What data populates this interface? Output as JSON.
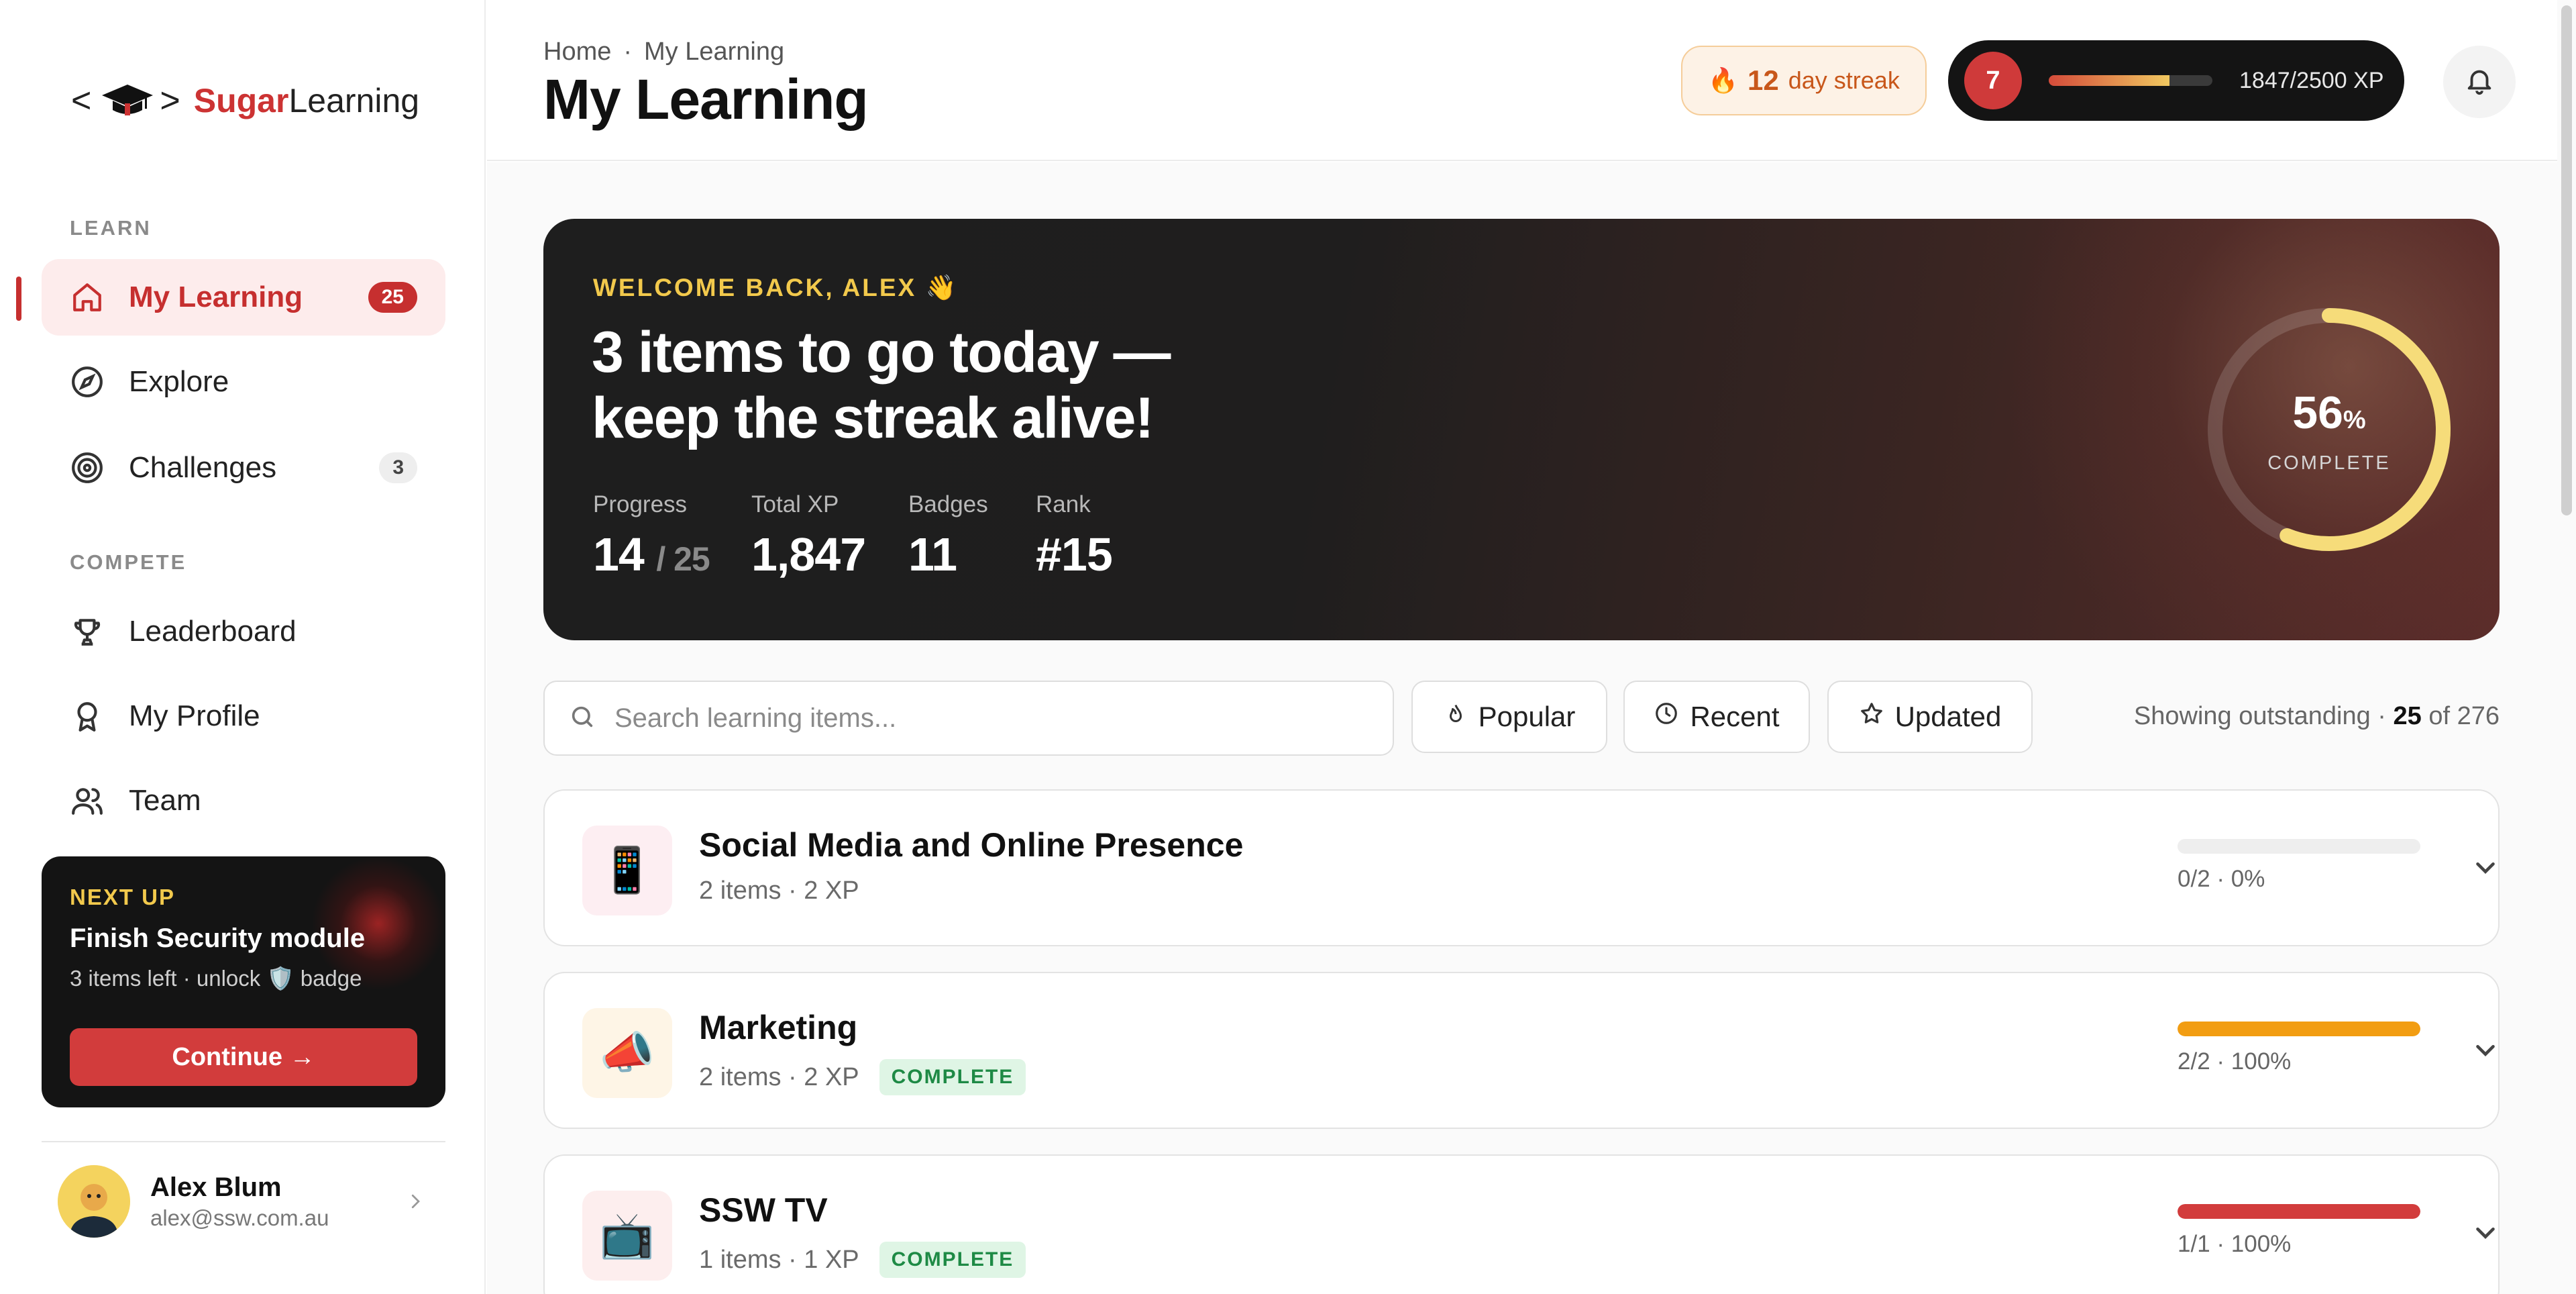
{
  "brand": {
    "bracket_left": "<",
    "bracket_right": ">",
    "name_a": "Sugar",
    "name_b": "Learning"
  },
  "sidebar": {
    "learn_label": "LEARN",
    "compete_label": "COMPETE",
    "items": [
      {
        "label": "My Learning",
        "count": "25",
        "icon": "home-icon",
        "active": true
      },
      {
        "label": "Explore",
        "icon": "compass-icon"
      },
      {
        "label": "Challenges",
        "count": "3",
        "icon": "target-icon"
      },
      {
        "label": "Leaderboard",
        "icon": "trophy-icon"
      },
      {
        "label": "My Profile",
        "icon": "award-icon"
      },
      {
        "label": "Team",
        "icon": "users-icon"
      }
    ],
    "next_up": {
      "tag": "NEXT UP",
      "title": "Finish Security module",
      "sub_prefix": "3 items left · unlock",
      "badge_emoji": "🛡️",
      "sub_suffix": "badge",
      "button": "Continue →"
    },
    "user": {
      "name": "Alex Blum",
      "email": "alex@ssw.com.au"
    }
  },
  "header": {
    "breadcrumb": [
      "Home",
      "·",
      "My Learning"
    ],
    "title": "My Learning",
    "streak": {
      "icon": "🔥",
      "count": "12",
      "label": "day streak"
    },
    "xp": {
      "level": "7",
      "label": "1847/2500 XP",
      "progress": 0.7388
    }
  },
  "hero": {
    "welcome": "WELCOME BACK, ALEX 👋",
    "headline": "3 items to go today — keep the streak alive!",
    "stats": [
      {
        "label": "Progress",
        "value": "14",
        "suffix": "/ 25"
      },
      {
        "label": "Total XP",
        "value": "1,847"
      },
      {
        "label": "Badges",
        "value": "11"
      },
      {
        "label": "Rank",
        "value": "#15"
      }
    ],
    "ring": {
      "percent": "56",
      "percent_sign": "%",
      "caption": "COMPLETE",
      "fraction": 0.56
    }
  },
  "toolbar": {
    "search_placeholder": "Search learning items...",
    "chips": [
      "Popular",
      "Recent",
      "Updated"
    ],
    "showing_prefix": "Showing outstanding ·",
    "showing_count": "25",
    "showing_suffix": "of 276"
  },
  "rows": [
    {
      "emoji": "📱",
      "title": "Social Media and Online Presence",
      "meta": "2 items · 2 XP",
      "complete": false,
      "progress_text": "0/2 · 0%",
      "progress": 0,
      "color": "#e0e0e0",
      "tint": "#fdeef2"
    },
    {
      "emoji": "📣",
      "title": "Marketing",
      "meta": "2 items · 2 XP",
      "complete": true,
      "badge": "COMPLETE",
      "progress_text": "2/2 · 100%",
      "progress": 1,
      "color": "#f29d12",
      "tint": "#fef5e6"
    },
    {
      "emoji": "📺",
      "title": "SSW TV",
      "meta": "1 items · 1 XP",
      "complete": true,
      "badge": "COMPLETE",
      "progress_text": "1/1 · 100%",
      "progress": 1,
      "color": "#d23c3c",
      "tint": "#fdeeee"
    }
  ]
}
